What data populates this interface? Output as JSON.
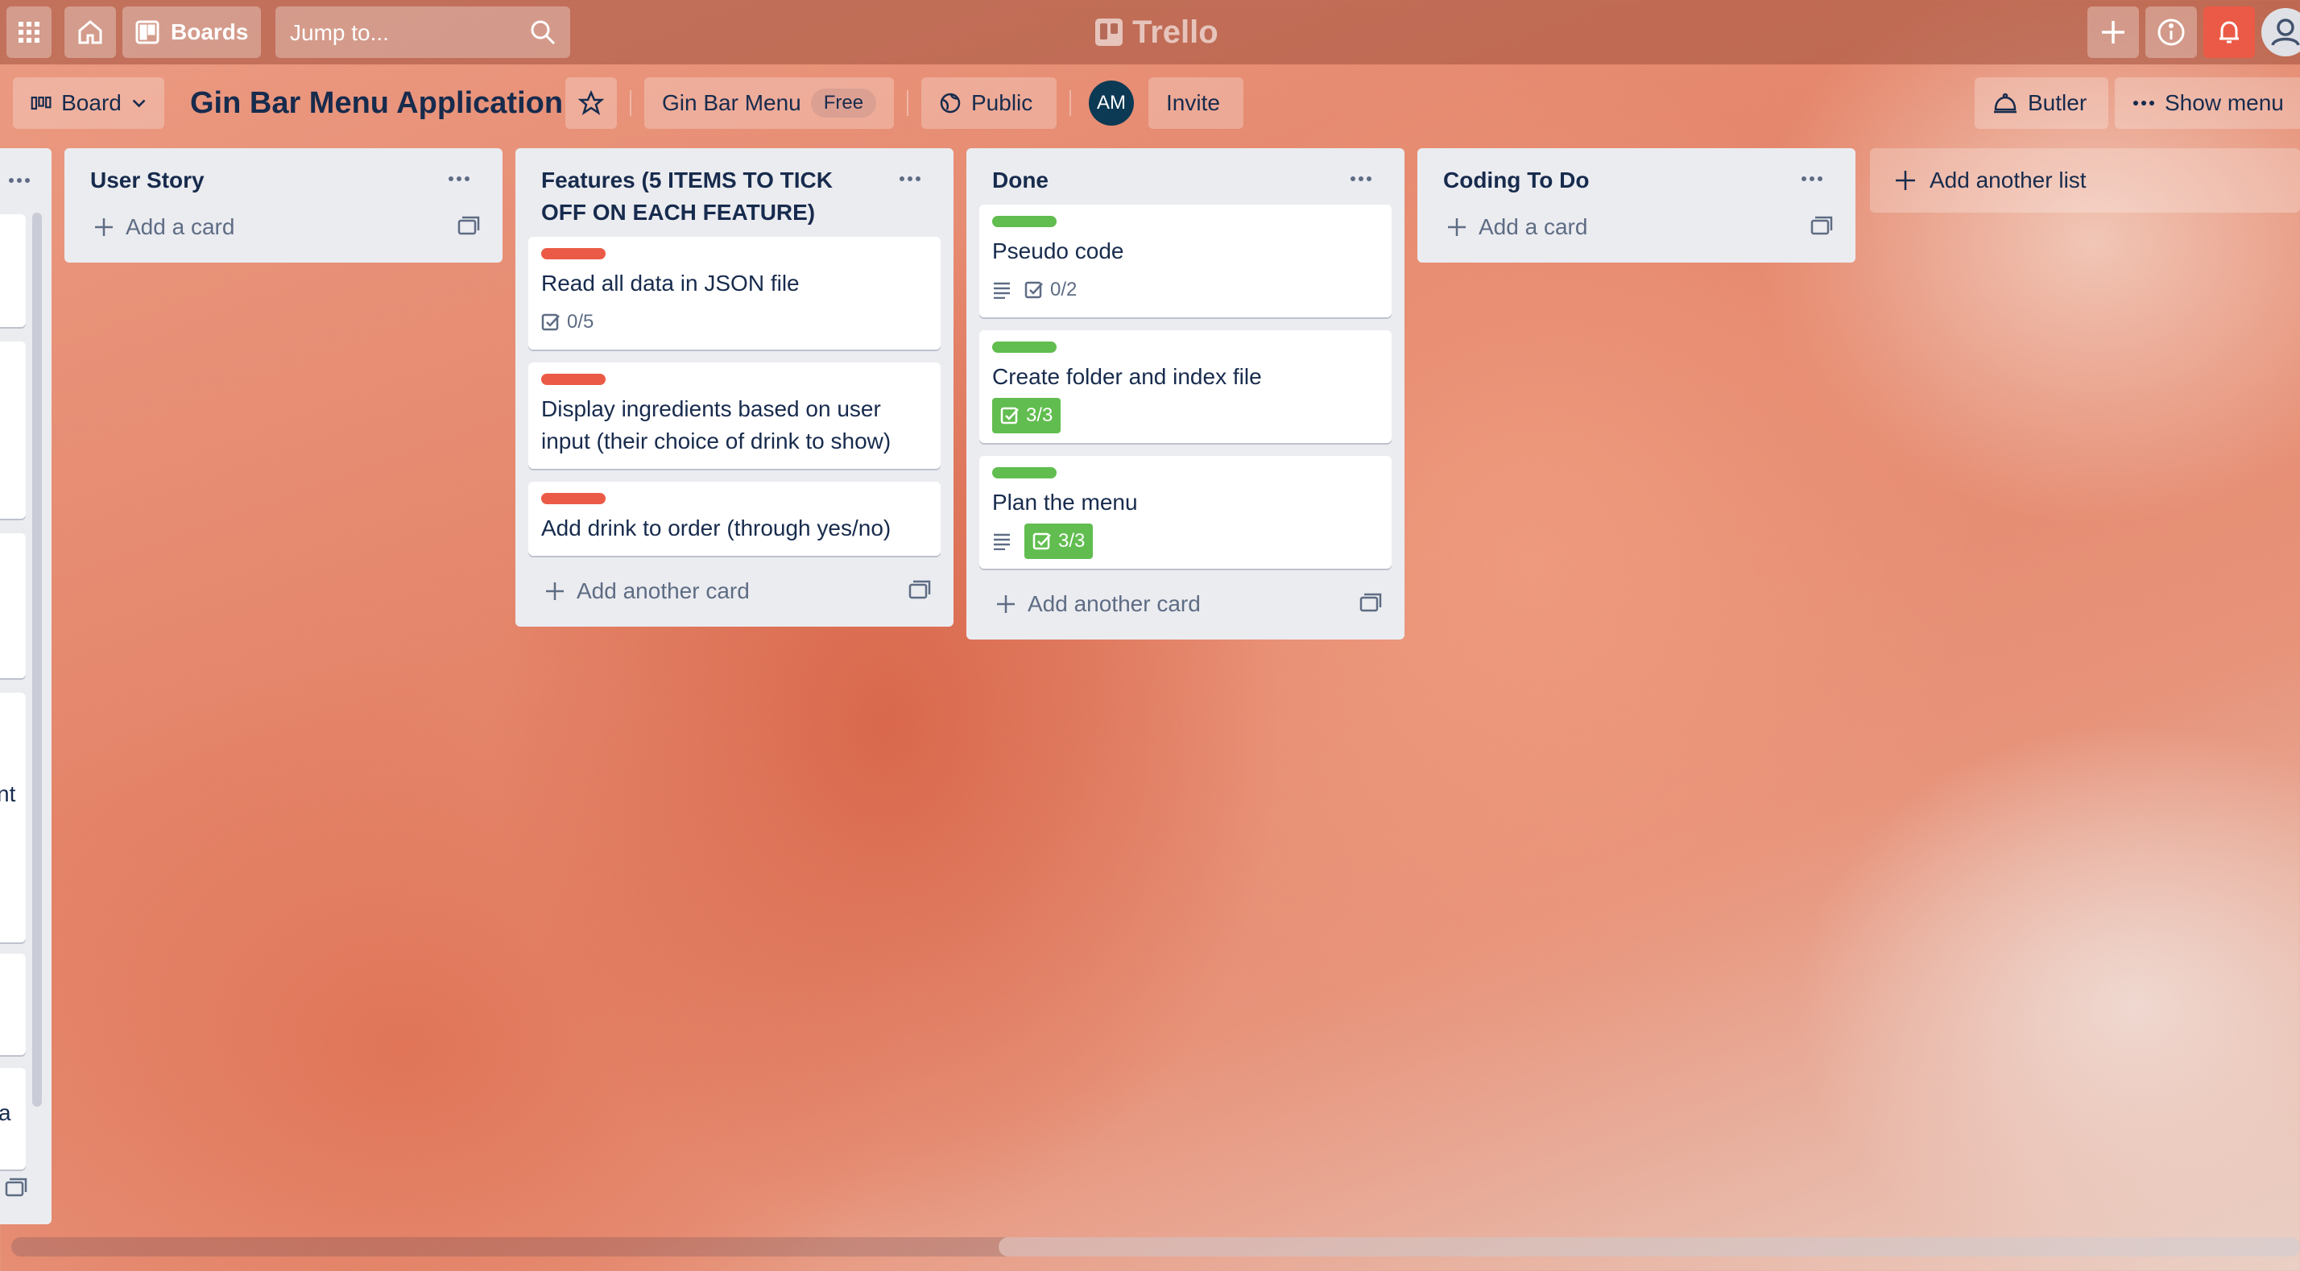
{
  "header": {
    "boards_label": "Boards",
    "search_placeholder": "Jump to...",
    "logo_text": "Trello"
  },
  "board_header": {
    "view_label": "Board",
    "title": "Gin Bar Menu Application",
    "workspace_name": "Gin Bar Menu",
    "workspace_plan": "Free",
    "visibility": "Public",
    "member_initials": "AM",
    "invite_label": "Invite",
    "butler_label": "Butler",
    "show_menu_label": "Show menu"
  },
  "partial_list": {
    "fragment_1": "nt",
    "fragment_2": "a"
  },
  "lists": [
    {
      "title": "User Story",
      "cards": [],
      "add_label": "Add a card"
    },
    {
      "title": "Features (5 ITEMS TO TICK OFF ON EACH FEATURE)",
      "cards": [
        {
          "label_color": "#eb5a46",
          "title": "Read all data in JSON file",
          "checklist": "0/5"
        },
        {
          "label_color": "#eb5a46",
          "title": "Display ingredients based on user input (their choice of drink to show)"
        },
        {
          "label_color": "#eb5a46",
          "title": "Add drink to order (through yes/no)"
        }
      ],
      "add_label": "Add another card"
    },
    {
      "title": "Done",
      "cards": [
        {
          "label_color": "#61bd4f",
          "title": "Pseudo code",
          "checklist": "0/2"
        },
        {
          "label_color": "#61bd4f",
          "title": "Create folder and index file",
          "checklist": "3/3"
        },
        {
          "label_color": "#61bd4f",
          "title": "Plan the menu",
          "checklist": "3/3"
        }
      ],
      "add_label": "Add another card"
    },
    {
      "title": "Coding To Do",
      "cards": [],
      "add_label": "Add a card"
    }
  ],
  "add_list_label": "Add another list",
  "colors": {
    "label_red": "#eb5a46",
    "label_green": "#61bd4f",
    "notification": "#eb5a46",
    "list_bg": "#ebecf0"
  }
}
